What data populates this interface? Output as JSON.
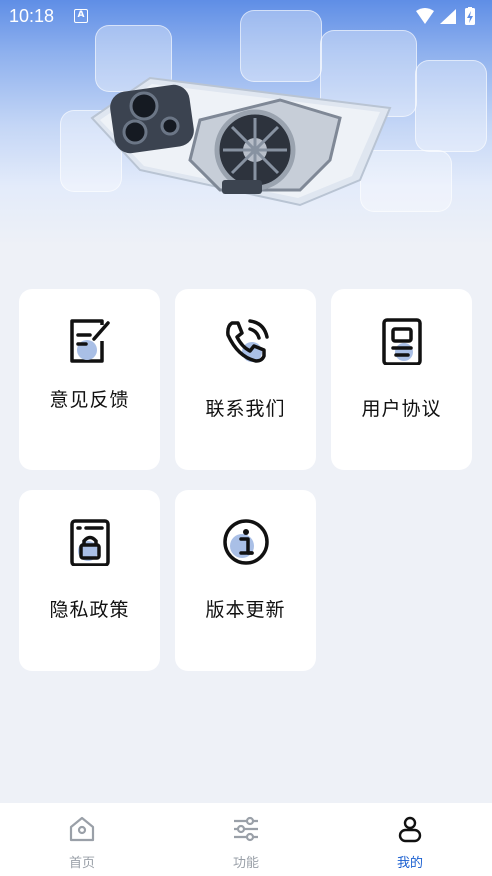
{
  "status_bar": {
    "time": "10:18",
    "notification_badge": "A",
    "icons": [
      "wifi-icon",
      "signal-icon",
      "battery-charging-icon"
    ]
  },
  "hero": {
    "image": "phone-cooler-on-ice-banner"
  },
  "menu": {
    "items": [
      {
        "label": "意见反馈",
        "icon": "feedback-edit-icon"
      },
      {
        "label": "联系我们",
        "icon": "phone-call-icon"
      },
      {
        "label": "用户协议",
        "icon": "user-agreement-document-icon"
      },
      {
        "label": "隐私政策",
        "icon": "privacy-lock-document-icon"
      },
      {
        "label": "版本更新",
        "icon": "info-icon"
      }
    ]
  },
  "tabbar": {
    "active_color": "#1a5fd0",
    "inactive_color": "#9aa0a8",
    "tabs": [
      {
        "label": "首页",
        "icon": "home-icon",
        "active": false
      },
      {
        "label": "功能",
        "icon": "sliders-icon",
        "active": false
      },
      {
        "label": "我的",
        "icon": "user-icon",
        "active": true
      }
    ]
  }
}
